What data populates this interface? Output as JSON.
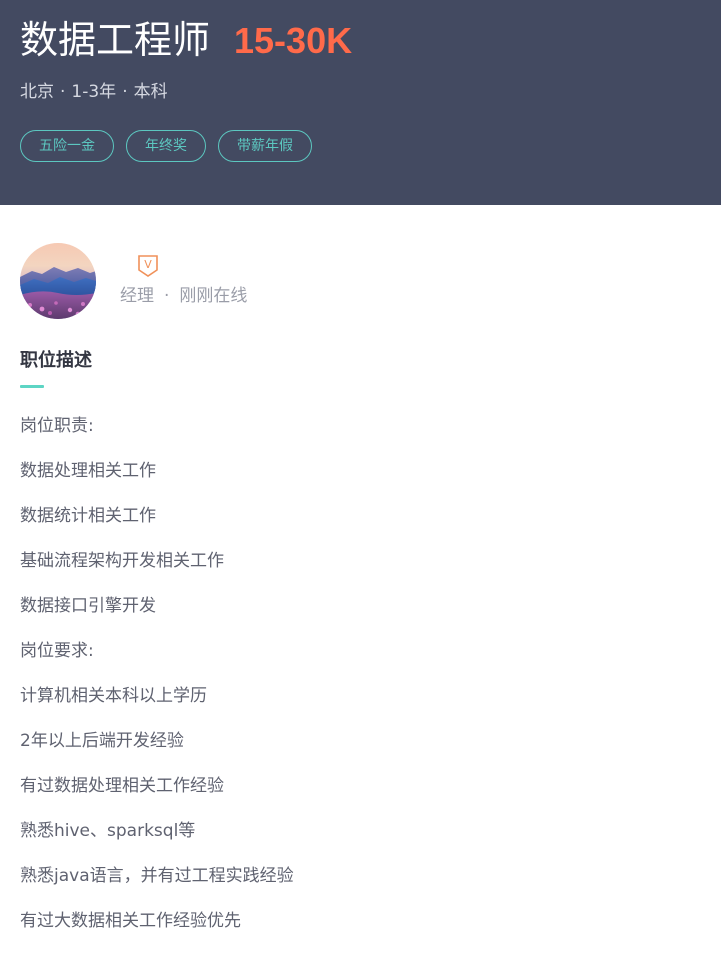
{
  "job": {
    "title": "数据工程师",
    "salary": "15-30K",
    "location": "北京",
    "experience": "1-3年",
    "education": "本科",
    "separator": "·",
    "tags": [
      "五险一金",
      "年终奖",
      "带薪年假"
    ]
  },
  "recruiter": {
    "verified_badge": "V",
    "role": "经理",
    "separator": "·",
    "status": "刚刚在线"
  },
  "description": {
    "title": "职位描述",
    "lines": [
      "岗位职责:",
      "数据处理相关工作",
      "数据统计相关工作",
      "基础流程架构开发相关工作",
      "数据接口引擎开发",
      "岗位要求:",
      "计算机相关本科以上学历",
      "2年以上后端开发经验",
      "有过数据处理相关工作经验",
      "熟悉hive、sparksql等",
      "熟悉java语言，并有过工程实践经验",
      "有过大数据相关工作经验优先"
    ]
  },
  "colors": {
    "header_bg": "#434a61",
    "salary": "#ff6a4a",
    "tag": "#5cc7c0",
    "accent": "#5dd5c4"
  }
}
